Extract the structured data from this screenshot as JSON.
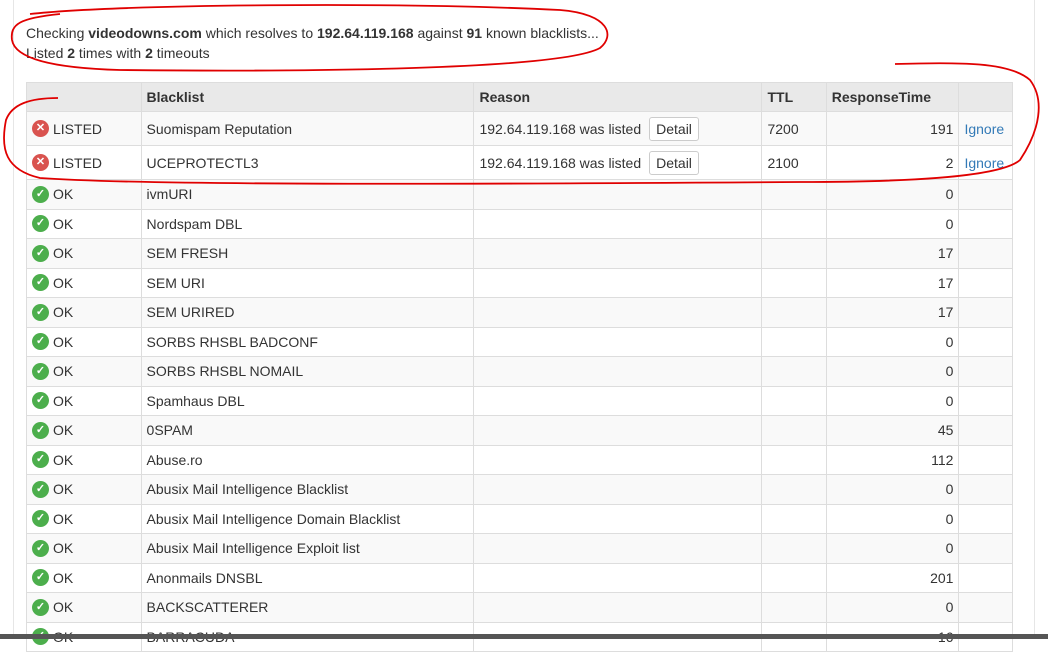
{
  "summary": {
    "line1_prefix": "Checking ",
    "domain": "videodowns.com",
    "line1_mid": " which resolves to ",
    "ip": "192.64.119.168",
    "line1_mid2": " against ",
    "count": "91",
    "line1_suffix": " known blacklists...",
    "line2_prefix": "Listed ",
    "listed": "2",
    "line2_mid": " times with ",
    "timeouts": "2",
    "line2_suffix": " timeouts"
  },
  "table": {
    "headers": [
      "",
      "Blacklist",
      "Reason",
      "TTL",
      "ResponseTime",
      ""
    ],
    "listed_rows": [
      {
        "status": "LISTED",
        "blacklist": "Suomispam Reputation",
        "reason": "192.64.119.168 was listed",
        "detail": "Detail",
        "ttl": "7200",
        "response": "191",
        "ignore": "Ignore"
      },
      {
        "status": "LISTED",
        "blacklist": "UCEPROTECTL3",
        "reason": "192.64.119.168 was listed",
        "detail": "Detail",
        "ttl": "2100",
        "response": "2",
        "ignore": "Ignore"
      }
    ],
    "ok_rows": [
      {
        "status": "OK",
        "blacklist": "ivmURI",
        "response": "0"
      },
      {
        "status": "OK",
        "blacklist": "Nordspam DBL",
        "response": "0"
      },
      {
        "status": "OK",
        "blacklist": "SEM FRESH",
        "response": "17"
      },
      {
        "status": "OK",
        "blacklist": "SEM URI",
        "response": "17"
      },
      {
        "status": "OK",
        "blacklist": "SEM URIRED",
        "response": "17"
      },
      {
        "status": "OK",
        "blacklist": "SORBS RHSBL BADCONF",
        "response": "0"
      },
      {
        "status": "OK",
        "blacklist": "SORBS RHSBL NOMAIL",
        "response": "0"
      },
      {
        "status": "OK",
        "blacklist": "Spamhaus DBL",
        "response": "0"
      },
      {
        "status": "OK",
        "blacklist": "0SPAM",
        "response": "45"
      },
      {
        "status": "OK",
        "blacklist": "Abuse.ro",
        "response": "112"
      },
      {
        "status": "OK",
        "blacklist": "Abusix Mail Intelligence Blacklist",
        "response": "0"
      },
      {
        "status": "OK",
        "blacklist": "Abusix Mail Intelligence Domain Blacklist",
        "response": "0"
      },
      {
        "status": "OK",
        "blacklist": "Abusix Mail Intelligence Exploit list",
        "response": "0"
      },
      {
        "status": "OK",
        "blacklist": "Anonmails DNSBL",
        "response": "201"
      },
      {
        "status": "OK",
        "blacklist": "BACKSCATTERER",
        "response": "0"
      },
      {
        "status": "OK",
        "blacklist": "BARRACUDA",
        "response": "16"
      }
    ]
  },
  "icons": {
    "ok": "check-circle-icon",
    "listed": "x-circle-icon"
  },
  "colors": {
    "ok": "#4cae4c",
    "listed": "#d9534f",
    "link": "#337ab7",
    "annotation": "#e00000"
  }
}
